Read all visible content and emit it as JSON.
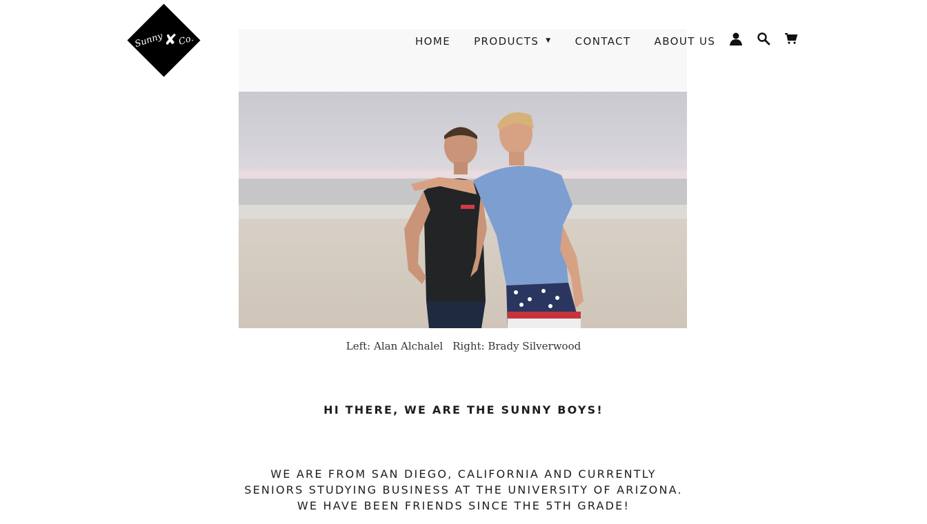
{
  "logo": {
    "word_left": "Sunny",
    "word_right": "Co.",
    "icon": "seahorse-icon"
  },
  "nav": {
    "items": [
      {
        "label": "HOME"
      },
      {
        "label": "PRODUCTS",
        "has_dropdown": true
      },
      {
        "label": "CONTACT"
      },
      {
        "label": "ABOUT US"
      }
    ],
    "icons": [
      "account-icon",
      "search-icon",
      "cart-icon"
    ]
  },
  "hero": {
    "alt": "Two friends standing on a beach"
  },
  "caption": {
    "left": "Left: Alan Alchalel",
    "right": "Right: Brady Silverwood"
  },
  "headline": "HI THERE, WE ARE THE SUNNY BOYS!",
  "about": {
    "line1": "WE ARE FROM SAN DIEGO, CALIFORNIA AND CURRENTLY",
    "line2": "SENIORS STUDYING BUSINESS AT THE UNIVERSITY OF ARIZONA.",
    "line3": "WE HAVE BEEN FRIENDS SINCE THE 5TH GRADE!"
  },
  "colors": {
    "text": "#1c1d1d",
    "logo_bg": "#000000",
    "background": "#ffffff"
  }
}
